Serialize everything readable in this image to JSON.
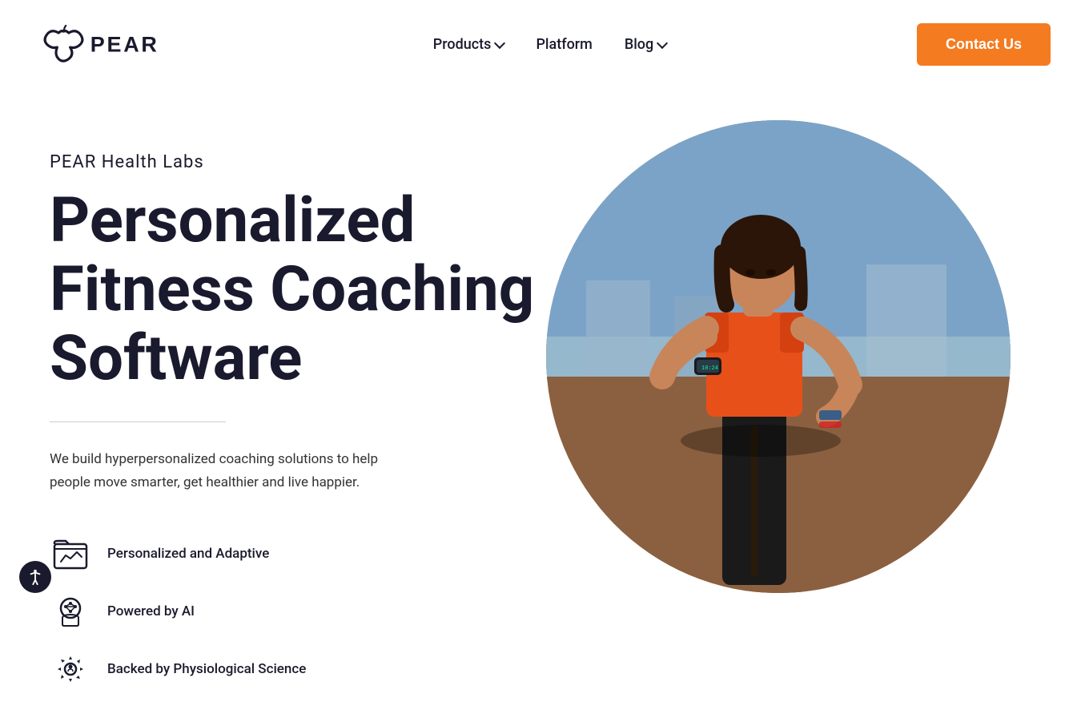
{
  "navbar": {
    "logo_alt": "PEAR Health Labs Logo",
    "nav_items": [
      {
        "id": "products",
        "label": "Products",
        "has_dropdown": true
      },
      {
        "id": "platform",
        "label": "Platform",
        "has_dropdown": false
      },
      {
        "id": "blog",
        "label": "Blog",
        "has_dropdown": true
      }
    ],
    "contact_label": "Contact Us"
  },
  "hero": {
    "subtitle": "PEAR Health Labs",
    "title_line1": "Personalized",
    "title_line2": "Fitness Coaching",
    "title_line3": "Software",
    "description": "We build hyperpersonalized coaching solutions to help people move smarter, get healthier and live happier.",
    "features": [
      {
        "id": "personalized",
        "label": "Personalized and Adaptive"
      },
      {
        "id": "ai",
        "label": "Powered by AI"
      },
      {
        "id": "physiological",
        "label": "Backed by Physiological Science"
      }
    ]
  },
  "accessibility": {
    "label": "Accessibility"
  },
  "colors": {
    "orange": "#f47b20",
    "navy": "#1a1a2e",
    "white": "#ffffff"
  }
}
